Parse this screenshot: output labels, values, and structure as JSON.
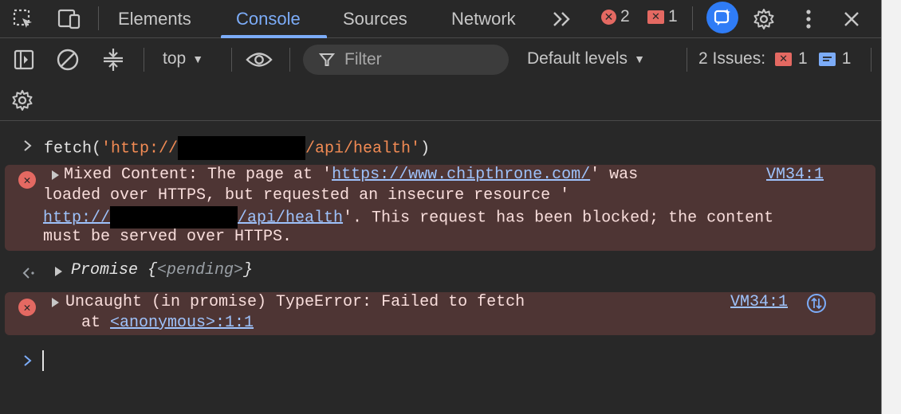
{
  "tabs": {
    "items": [
      {
        "label": "Elements"
      },
      {
        "label": "Console"
      },
      {
        "label": "Sources"
      },
      {
        "label": "Network"
      }
    ],
    "active": "Console",
    "more_label": ">>",
    "error_count": "2",
    "warning_count": "1"
  },
  "toolbar": {
    "context": "top",
    "filter_placeholder": "Filter",
    "levels": "Default levels",
    "issues_label": "2 Issues:",
    "issues_error_count": "1",
    "issues_info_count": "1"
  },
  "console": {
    "input_prefix": "fetch(",
    "input_str_start": "'http://",
    "input_str_end": "/api/health'",
    "input_suffix": ")",
    "error1": {
      "line1": "Mixed Content: The page at '",
      "line1_link": "https://www.chipthrone.com/",
      "line1_end": "' was",
      "line2": "loaded over HTTPS, but requested an insecure resource '",
      "line3_link_start": "http://",
      "line3_link_end": "/api/health",
      "line3_end": "'. This request has been blocked; the content",
      "line4": "must be served over HTTPS.",
      "source": "VM34:1"
    },
    "promise": {
      "label": "Promise",
      "open": " {",
      "state": "<pending>",
      "close": "}"
    },
    "error2": {
      "line1": "Uncaught (in promise) TypeError: Failed to fetch",
      "line2_prefix": "    at ",
      "line2_link": "<anonymous>:1:1",
      "source": "VM34:1"
    }
  },
  "colors": {
    "background": "#282828",
    "accent": "#7cacf8",
    "error": "#e46962",
    "error_row_bg": "#4e3534",
    "string": "#f28b54"
  }
}
